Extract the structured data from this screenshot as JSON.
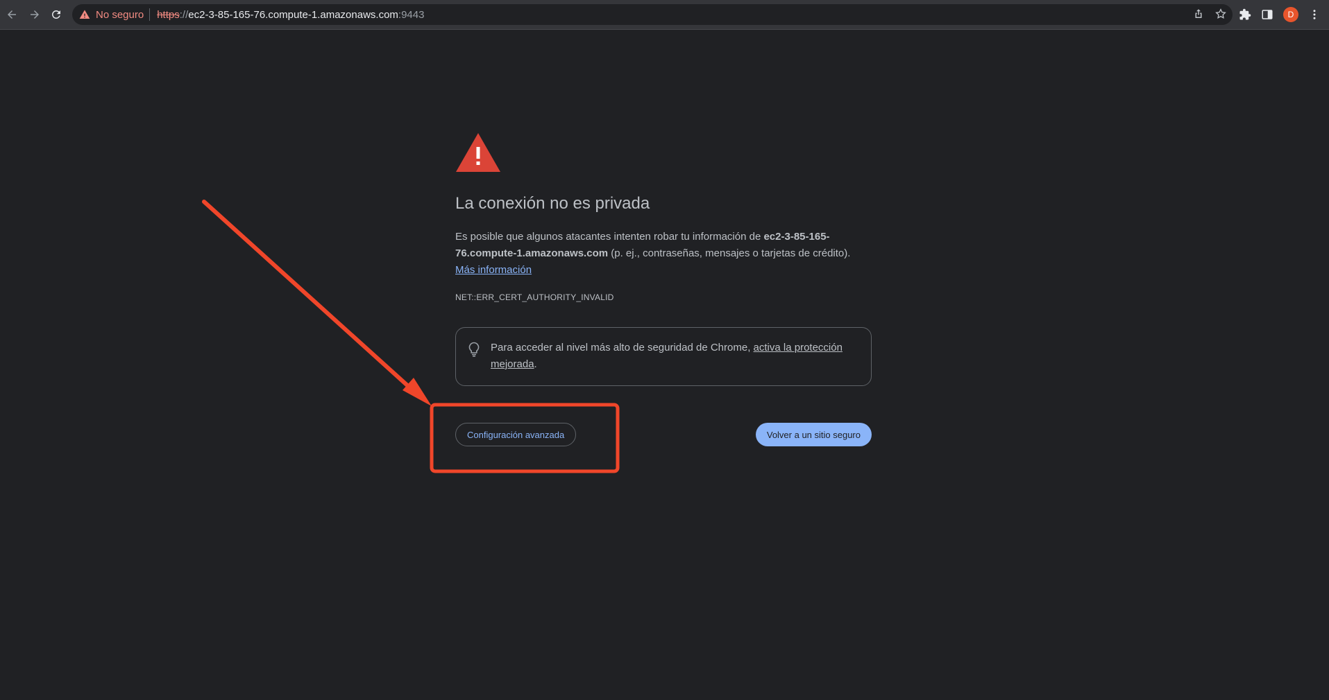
{
  "toolbar": {
    "back_icon": "arrow-left-icon",
    "forward_icon": "arrow-right-icon",
    "reload_icon": "reload-icon",
    "security_chip": "No seguro",
    "url_scheme": "https",
    "url_separator": "://",
    "url_host": "ec2-3-85-165-76.compute-1.amazonaws.com",
    "url_port": ":9443",
    "avatar_letter": "D"
  },
  "page": {
    "heading": "La conexión no es privada",
    "para_before": "Es posible que algunos atacantes intenten robar tu información de ",
    "host_bold": "ec2-3-85-165-76.compute-1.amazonaws.com",
    "para_after": " (p. ej., contraseñas, mensajes o tarjetas de crédito).",
    "more_info": "Más información",
    "error_code": "NET::ERR_CERT_AUTHORITY_INVALID",
    "enhanced_before": "Para acceder al nivel más alto de seguridad de Chrome, ",
    "enhanced_link": "activa la protección mejorada",
    "enhanced_after": ".",
    "advanced_button": "Configuración avanzada",
    "back_button": "Volver a un sitio seguro"
  },
  "colors": {
    "background": "#202124",
    "warning_red": "#db4437",
    "link_blue": "#8ab4f8",
    "annotation_red": "#f0462a"
  }
}
